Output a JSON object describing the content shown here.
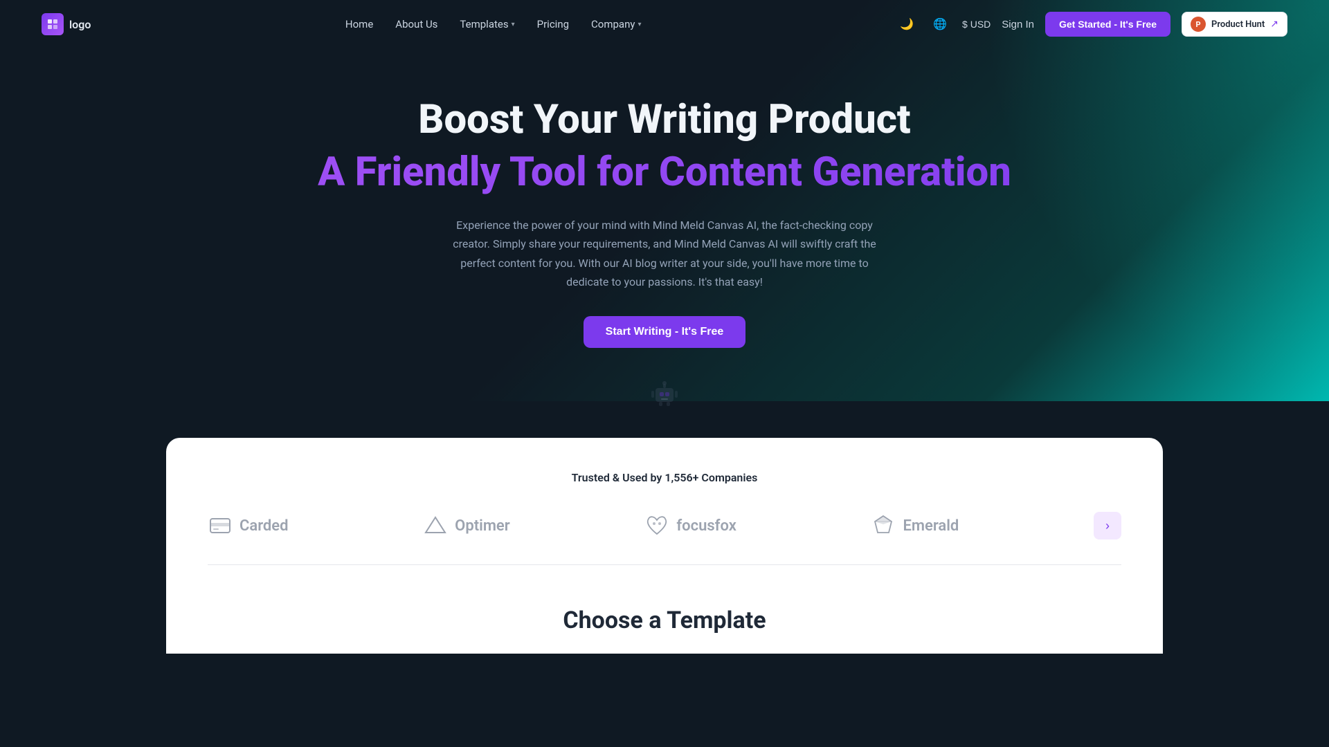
{
  "nav": {
    "logo_text": "logo",
    "links": [
      {
        "id": "home",
        "label": "Home",
        "has_dropdown": false
      },
      {
        "id": "about",
        "label": "About Us",
        "has_dropdown": false
      },
      {
        "id": "templates",
        "label": "Templates",
        "has_dropdown": true
      },
      {
        "id": "pricing",
        "label": "Pricing",
        "has_dropdown": false
      },
      {
        "id": "company",
        "label": "Company",
        "has_dropdown": true
      }
    ],
    "currency": "$ USD",
    "sign_in": "Sign In",
    "get_started": "Get Started - It's Free",
    "product_hunt_label": "Product Hunt",
    "dark_mode_icon": "🌙",
    "globe_icon": "🌐"
  },
  "hero": {
    "title_line1": "Boost Your Writing Product",
    "title_line2": "A Friendly Tool for Content Generation",
    "description": "Experience the power of your mind with Mind Meld Canvas AI, the fact-checking copy creator. Simply share your requirements, and Mind Meld Canvas AI will swiftly craft the perfect content for you. With our AI blog writer at your side, you'll have more time to dedicate to your passions. It's that easy!",
    "cta_label": "Start Writing - It's Free"
  },
  "trusted": {
    "title": "Trusted & Used by 1,556+ Companies",
    "companies": [
      {
        "id": "carded",
        "name": "Carded",
        "icon": "card"
      },
      {
        "id": "optimer",
        "name": "Optimer",
        "icon": "send"
      },
      {
        "id": "focusfox",
        "name": "focusfox",
        "icon": "focus"
      },
      {
        "id": "emerald",
        "name": "Emerald",
        "icon": "gem"
      }
    ],
    "next_arrow": "›"
  },
  "bottom": {
    "choose_template_title": "Choose a Template"
  }
}
